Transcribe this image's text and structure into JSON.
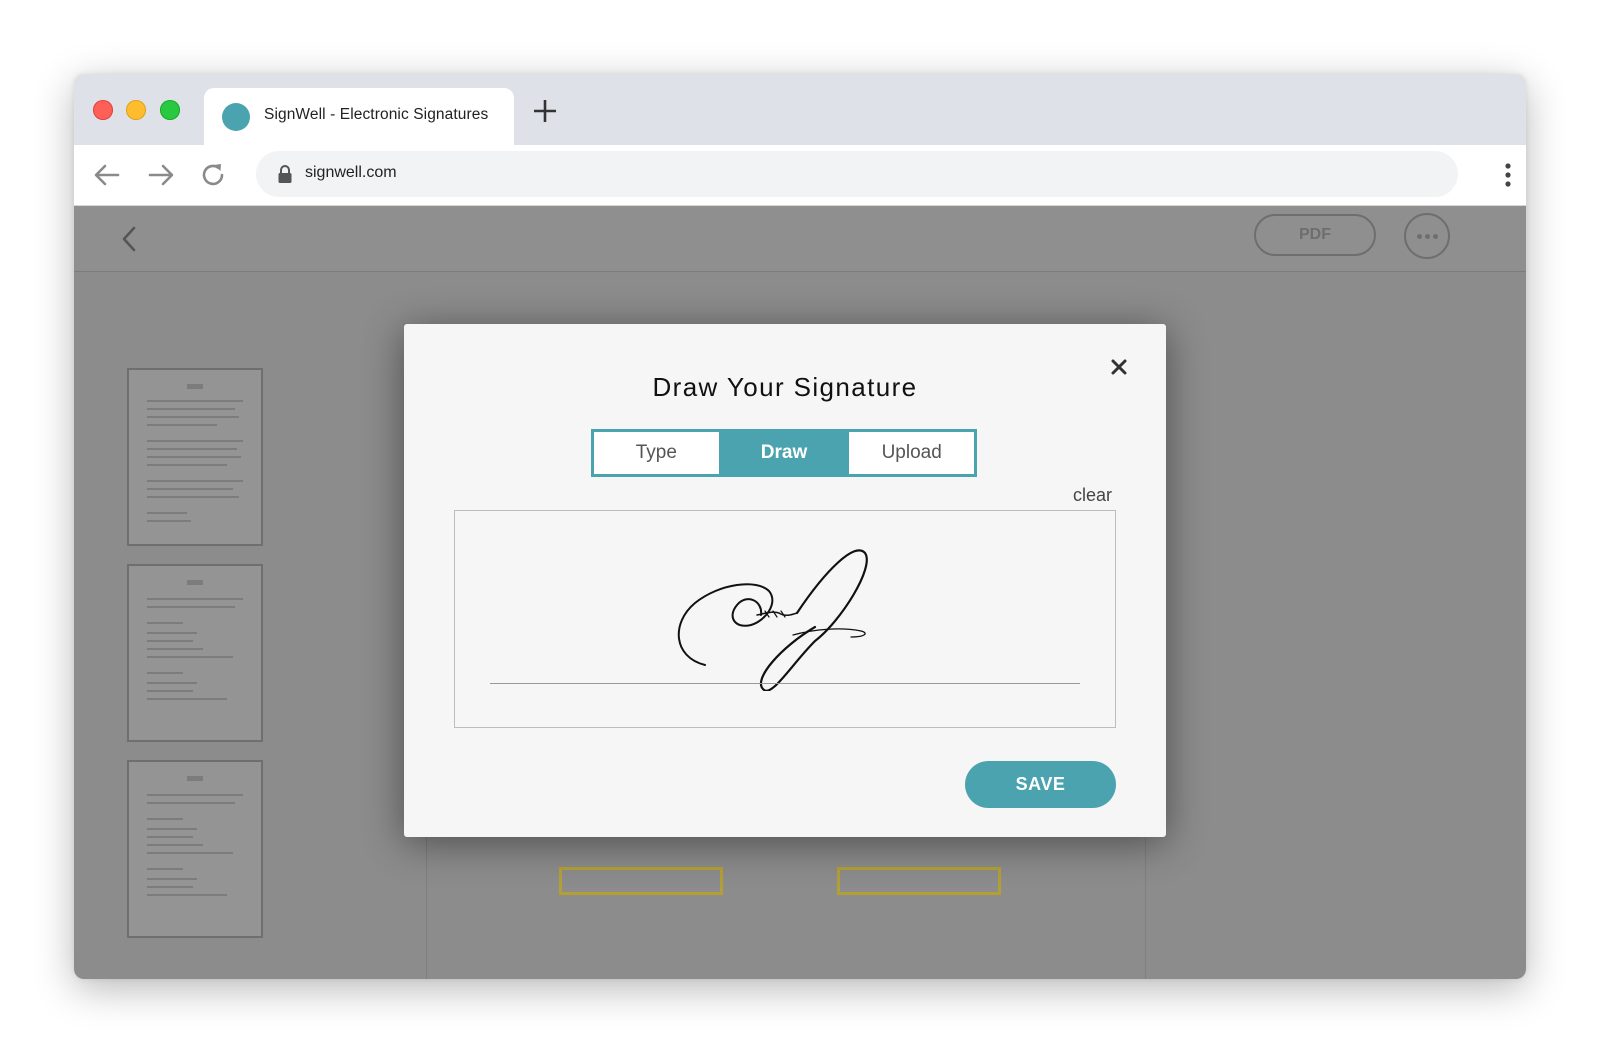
{
  "browser": {
    "tab_title": "SignWell - Electronic Signatures",
    "url": "signwell.com"
  },
  "app_header": {
    "pdf_label": "PDF"
  },
  "modal": {
    "title": "Draw Your Signature",
    "tabs": [
      {
        "label": "Type",
        "active": false
      },
      {
        "label": "Draw",
        "active": true
      },
      {
        "label": "Upload",
        "active": false
      }
    ],
    "clear_label": "clear",
    "save_label": "SAVE"
  },
  "colors": {
    "accent": "#4aa3ae",
    "overlay": "#8c8c8c"
  }
}
